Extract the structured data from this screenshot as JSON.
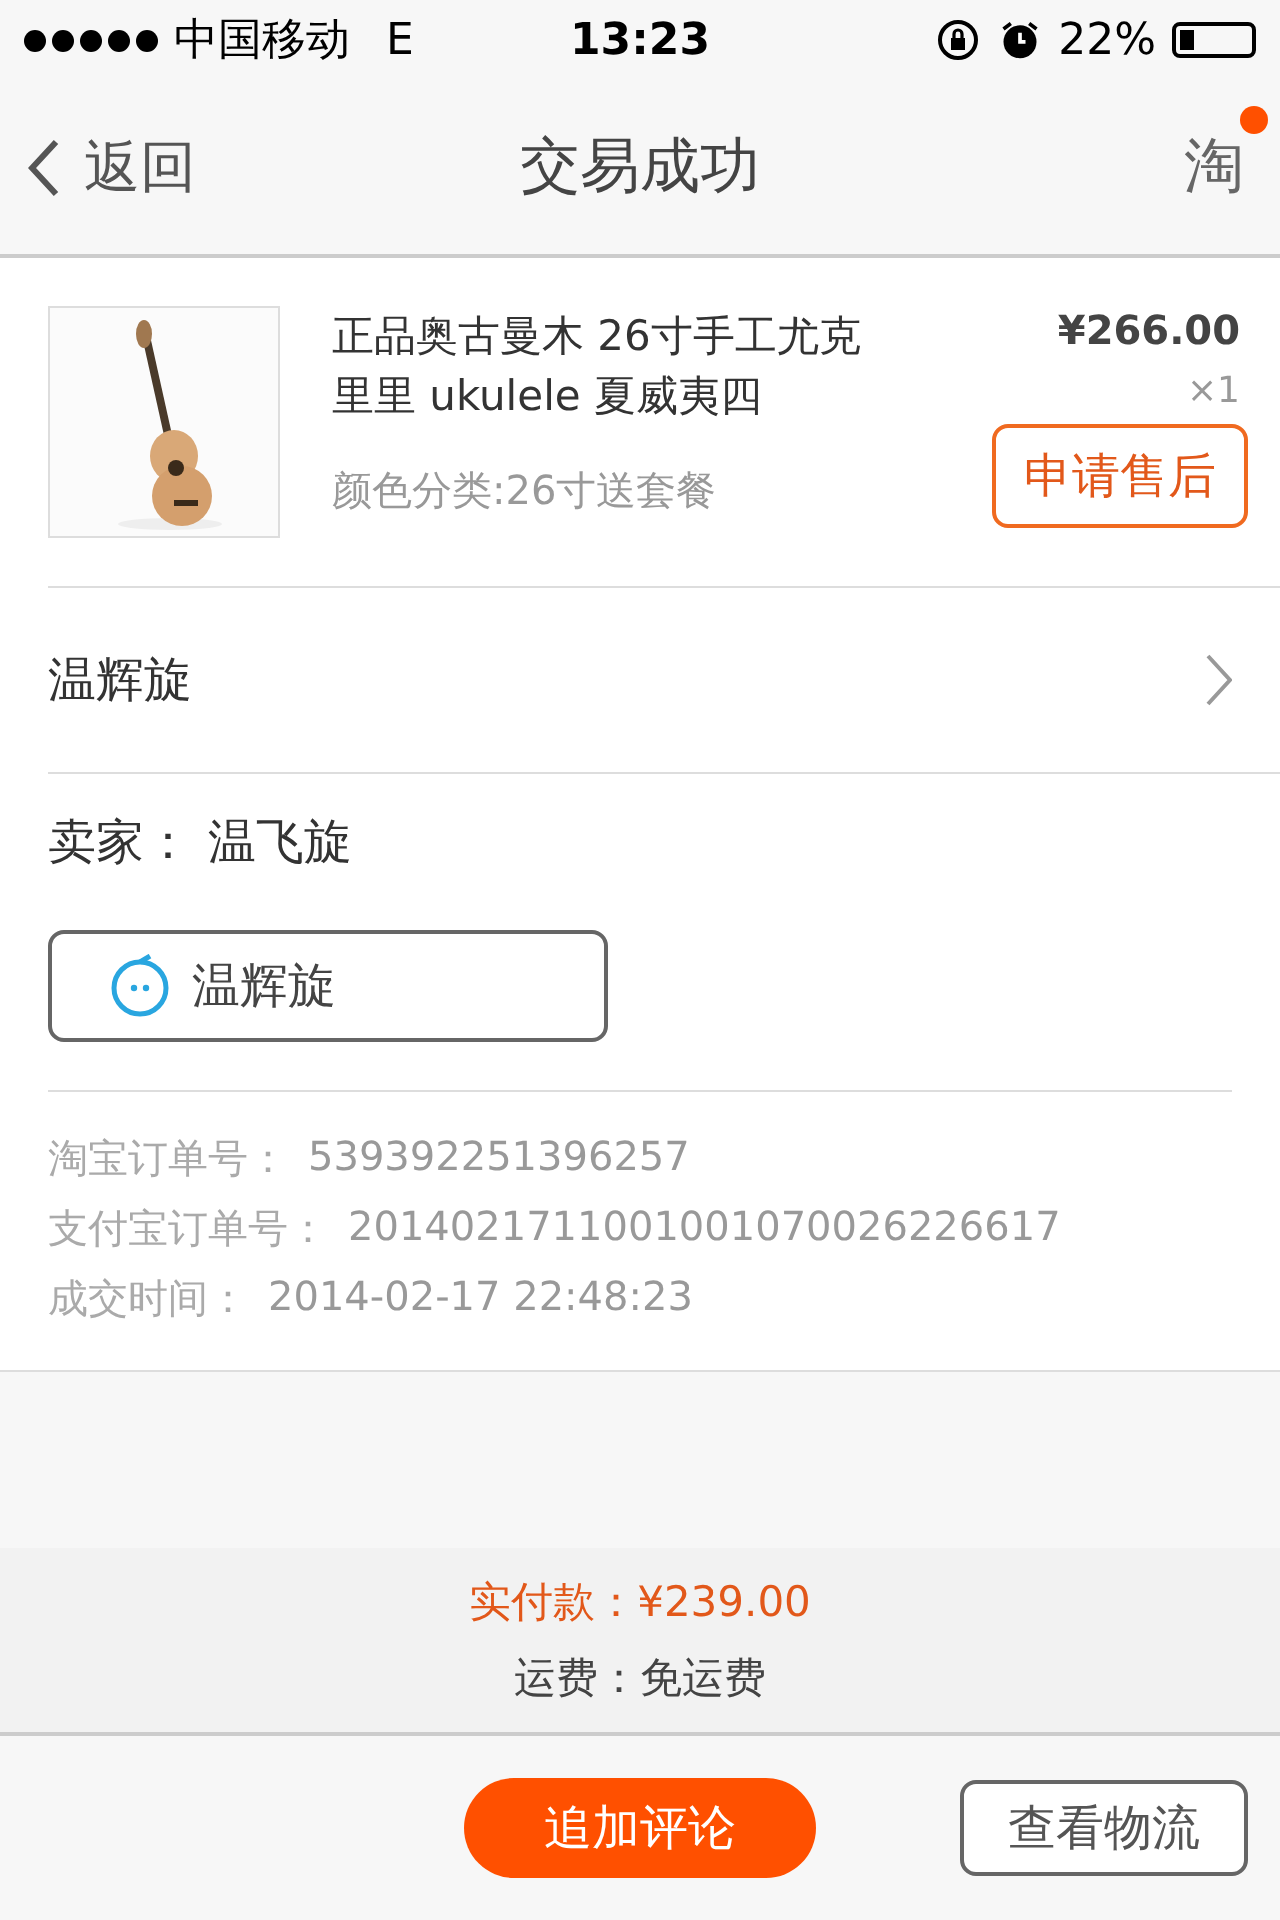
{
  "status_bar": {
    "carrier": "中国移动",
    "network": "E",
    "time": "13:23",
    "battery": "22%"
  },
  "nav": {
    "back": "返回",
    "title": "交易成功",
    "tao": "淘",
    "notification": true
  },
  "product": {
    "title": "正品奥古曼木 26寸手工尤克里里 ukulele 夏威夷四",
    "variant": "颜色分类:26寸送套餐",
    "price": "¥266.00",
    "quantity": "×1",
    "after_sale": "申请售后"
  },
  "buyer_row": {
    "label": "温辉旋"
  },
  "seller": {
    "label": "卖家：",
    "name": "温飞旋",
    "chat_button": "温辉旋"
  },
  "order_info": [
    {
      "label": "淘宝订单号：",
      "value": "539392251396257"
    },
    {
      "label": "支付宝订单号：",
      "value": "2014021711001001070026226617"
    },
    {
      "label": "成交时间：",
      "value": "2014-02-17 22:48:23"
    }
  ],
  "summary": {
    "paid": "实付款：¥239.00",
    "shipping": "运费：免运费"
  },
  "buttons": [
    {
      "label": "追加评论",
      "kind": "primary"
    },
    {
      "label": "查看物流",
      "kind": "outline"
    }
  ]
}
